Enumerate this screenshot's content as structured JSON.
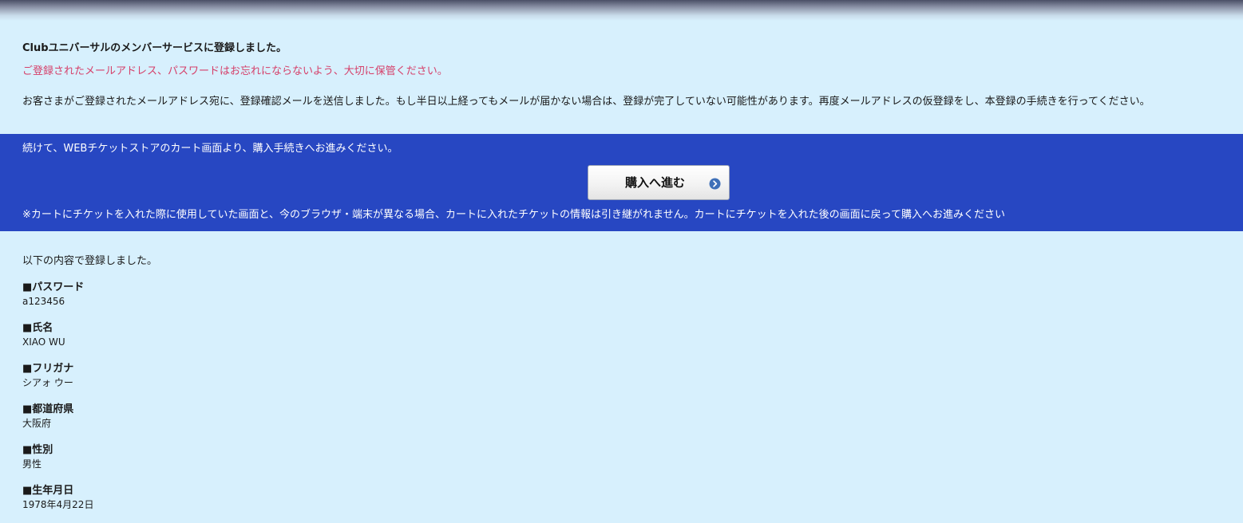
{
  "intro": {
    "title": "Clubユニバーサルのメンバーサービスに登録しました。",
    "warning": "ご登録されたメールアドレス、パスワードはお忘れにならないよう、大切に保管ください。",
    "notice": "お客さまがご登録されたメールアドレス宛に、登録確認メールを送信しました。もし半日以上経ってもメールが届かない場合は、登録が完了していない可能性があります。再度メールアドレスの仮登録をし、本登録の手続きを行ってください。"
  },
  "purchase": {
    "lead": "続けて、WEBチケットストアのカート画面より、購入手続きへお進みください。",
    "button_label": "購入へ進む",
    "note": "※カートにチケットを入れた際に使用していた画面と、今のブラウザ・端末が異なる場合、カートに入れたチケットの情報は引き継がれません。カートにチケットを入れた後の画面に戻って購入へお進みください"
  },
  "registered": {
    "lead": "以下の内容で登録しました。",
    "fields": [
      {
        "label": "■パスワード",
        "value": "a123456"
      },
      {
        "label": "■氏名",
        "value": "XIAO WU"
      },
      {
        "label": "■フリガナ",
        "value": "シアォ ウー"
      },
      {
        "label": "■都道府県",
        "value": "大阪府"
      },
      {
        "label": "■性別",
        "value": "男性"
      },
      {
        "label": "■生年月日",
        "value": "1978年4月22日"
      }
    ]
  },
  "colors": {
    "background": "#d7f0fd",
    "band": "#2747c2",
    "warning": "#d6406a",
    "icon": "#3f70b8"
  },
  "icons": {
    "button_icon": "chevron-right-circle-icon"
  }
}
